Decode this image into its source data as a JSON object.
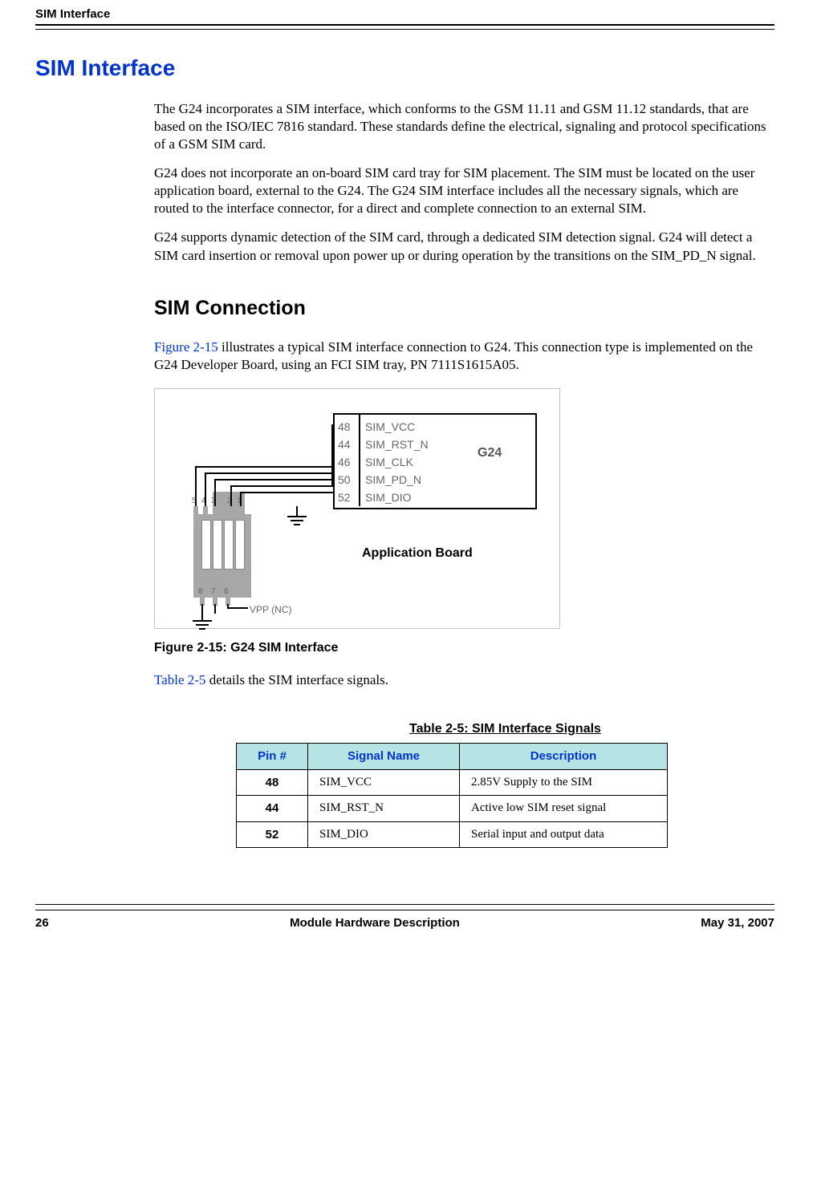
{
  "running_head": "SIM Interface",
  "section_title": "SIM Interface",
  "para1": "The G24 incorporates a SIM interface, which conforms to the GSM 11.11 and GSM 11.12 standards, that are based on the ISO/IEC 7816 standard. These standards define the electrical, signaling and protocol specifications of a GSM SIM card.",
  "para2": "G24 does not incorporate an on-board SIM card tray for SIM placement. The SIM must be located on the user application board, external to the G24. The G24 SIM interface includes all the necessary signals, which are routed to the interface connector, for a direct and complete connection to an external SIM.",
  "para3": "G24 supports dynamic detection of the SIM card, through a dedicated SIM detection signal. G24 will detect a SIM card insertion or removal upon power up or during operation by the transitions on the SIM_PD_N signal.",
  "subsection_title": "SIM Connection",
  "para4_link": "Figure 2-15",
  "para4_rest": " illustrates a typical SIM interface connection to G24. This connection type is implemented on the G24 Developer Board, using an FCI SIM tray, PN 7111S1615A05.",
  "figure": {
    "caption": "Figure 2-15: G24 SIM Interface",
    "conn_pins": [
      "48",
      "44",
      "46",
      "50",
      "52"
    ],
    "conn_signals": [
      "SIM_VCC",
      "SIM_RST_N",
      "SIM_CLK",
      "SIM_PD_N",
      "SIM_DIO"
    ],
    "g24_label": "G24",
    "app_board_label": "Application Board",
    "vpp_label": "VPP (NC)",
    "ic_top_pins": [
      "5",
      "4",
      "3",
      "2",
      "1"
    ],
    "ic_bot_pins": [
      "8",
      "7",
      "6"
    ]
  },
  "para5_link": "Table 2-5",
  "para5_rest": " details the SIM interface signals.",
  "table": {
    "caption": "Table 2-5: SIM Interface Signals",
    "headers": [
      "Pin #",
      "Signal Name",
      "Description"
    ],
    "rows": [
      {
        "pin": "48",
        "name": "SIM_VCC",
        "desc": "2.85V Supply to the SIM"
      },
      {
        "pin": "44",
        "name": "SIM_RST_N",
        "desc": "Active low SIM reset signal"
      },
      {
        "pin": "52",
        "name": "SIM_DIO",
        "desc": "Serial input and output data"
      }
    ]
  },
  "footer": {
    "page": "26",
    "center": "Module Hardware Description",
    "date": "May 31, 2007"
  }
}
